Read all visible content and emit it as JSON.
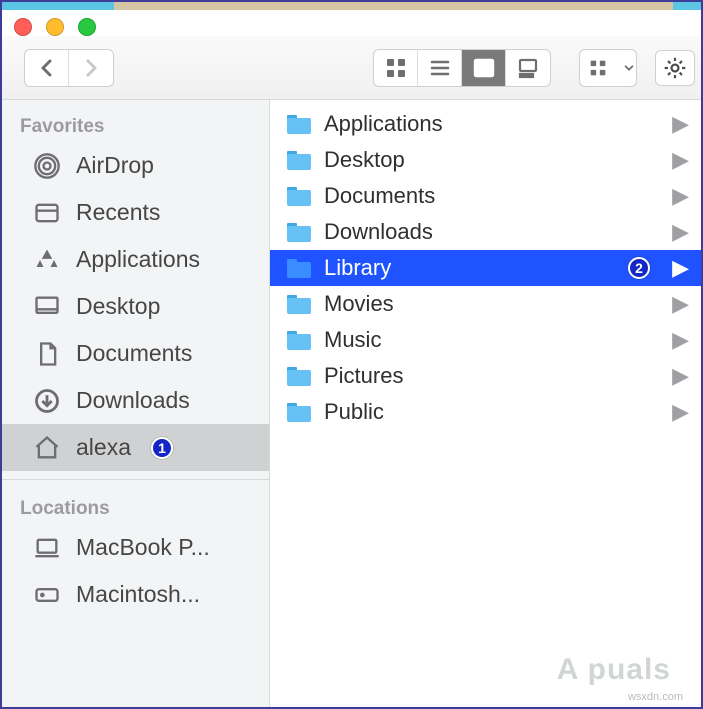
{
  "titlebar": {
    "close": "close",
    "minimize": "minimize",
    "zoom": "zoom"
  },
  "toolbar": {
    "nav": {
      "back": "back",
      "forward": "forward"
    },
    "views": {
      "icons": "icon-view",
      "list": "list-view",
      "columns": "column-view",
      "gallery": "gallery-view",
      "active": "columns"
    },
    "sort": "group-by",
    "action": "action-menu"
  },
  "sidebar": {
    "sections": [
      {
        "title": "Favorites",
        "items": [
          {
            "label": "AirDrop",
            "icon": "airdrop-icon"
          },
          {
            "label": "Recents",
            "icon": "recents-icon"
          },
          {
            "label": "Applications",
            "icon": "apps-icon"
          },
          {
            "label": "Desktop",
            "icon": "desktop-icon"
          },
          {
            "label": "Documents",
            "icon": "documents-icon"
          },
          {
            "label": "Downloads",
            "icon": "downloads-icon"
          },
          {
            "label": "alexa",
            "icon": "home-icon",
            "selected": true,
            "annotation": "1"
          }
        ]
      },
      {
        "title": "Locations",
        "items": [
          {
            "label": "MacBook P...",
            "icon": "laptop-icon"
          },
          {
            "label": "Macintosh...",
            "icon": "hdd-icon"
          }
        ]
      }
    ]
  },
  "content": {
    "items": [
      {
        "label": "Applications",
        "icon": "folder-apps",
        "has_children": true
      },
      {
        "label": "Desktop",
        "icon": "folder-desktop",
        "has_children": true
      },
      {
        "label": "Documents",
        "icon": "folder-generic",
        "has_children": true
      },
      {
        "label": "Downloads",
        "icon": "folder-generic",
        "has_children": true
      },
      {
        "label": "Library",
        "icon": "folder-library",
        "has_children": true,
        "selected": true,
        "annotation": "2"
      },
      {
        "label": "Movies",
        "icon": "folder-movies",
        "has_children": true
      },
      {
        "label": "Music",
        "icon": "folder-music",
        "has_children": true
      },
      {
        "label": "Pictures",
        "icon": "folder-pictures",
        "has_children": true
      },
      {
        "label": "Public",
        "icon": "folder-public",
        "has_children": true
      }
    ]
  },
  "watermark": {
    "brand": "A   puals",
    "source": "wsxdn.com"
  },
  "colors": {
    "selection_content": "#1e53ff",
    "selection_sidebar": "#cfd1d3",
    "folder_tint": "#66c2f4",
    "annotation_badge": "#1526c6"
  }
}
